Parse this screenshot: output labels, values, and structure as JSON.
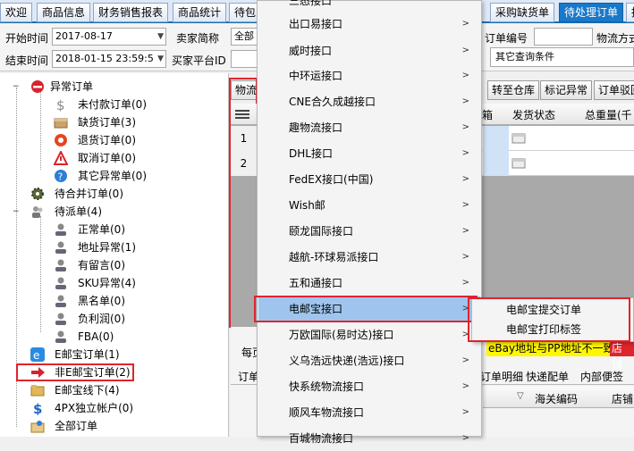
{
  "tabs": [
    "欢迎",
    "商品信息",
    "财务销售报表",
    "商品统计",
    "待包",
    "采购缺货单",
    "待处理订单",
    "拣"
  ],
  "filter": {
    "start_label": "开始时间",
    "start_value": "2017-08-17",
    "end_label": "结束时间",
    "end_value": "2018-01-15 23:59:5",
    "seller_label": "卖家简称",
    "seller_value": "全部",
    "platform_label": "买家平台ID",
    "order_no_label": "订单编号",
    "logistics_label": "物流方式",
    "other_query": "其它查询条件"
  },
  "tree": {
    "abnormal": "异常订单",
    "unpaid": "未付款订单(0)",
    "shortage": "缺货订单(3)",
    "refund": "退货订单(0)",
    "cancel": "取消订单(0)",
    "other_abnormal": "其它异常单(0)",
    "pending_merge": "待合并订单(0)",
    "pending_dispatch": "待派单(4)",
    "normal": "正常单(0)",
    "address_abnormal": "地址异常(1)",
    "message": "有留言(0)",
    "sku_abnormal": "SKU异常(4)",
    "blacklist": "黑名单(0)",
    "negative_profit": "负利润(0)",
    "fba": "FBA(0)",
    "ebay_orders": "E邮宝订单(1)",
    "non_ebay_orders": "非E邮宝订单(2)",
    "ebay_offline": "E邮宝线下(4)",
    "fourpx": "4PX独立帐户(0)",
    "all_orders": "全部订单"
  },
  "toolbar": {
    "logistics_btn": "物流",
    "to_warehouse": "转至仓库",
    "mark_abnormal": "标记异常",
    "order_reject": "订单驳回"
  },
  "grid": {
    "headers": [
      "箱",
      "发货状态",
      "总重量(千"
    ],
    "rows": [
      "1",
      "2"
    ]
  },
  "bottom": {
    "per_page": "每页",
    "mismatch": "eBay地址与PP地址不一致",
    "shop": "店铺",
    "tabs": [
      "订单",
      "订单明细",
      "快递配单",
      "内部便签"
    ],
    "customs_code": "海关编码",
    "shop_col": "店铺"
  },
  "menu": {
    "items": [
      "三态接口",
      "出口易接口",
      "威时接口",
      "中环运接口",
      "CNE合久成越接口",
      "趣物流接口",
      "DHL接口",
      "FedEX接口(中国)",
      "Wish邮",
      "颐龙国际接口",
      "越航-环球易派接口",
      "五和通接口",
      "电邮宝接口",
      "万欧国际(易时达)接口",
      "义乌浩远快递(浩远)接口",
      "快系统物流接口",
      "顺风车物流接口",
      "百城物流接口"
    ],
    "submenu": [
      "电邮宝提交订单",
      "电邮宝打印标签"
    ]
  }
}
